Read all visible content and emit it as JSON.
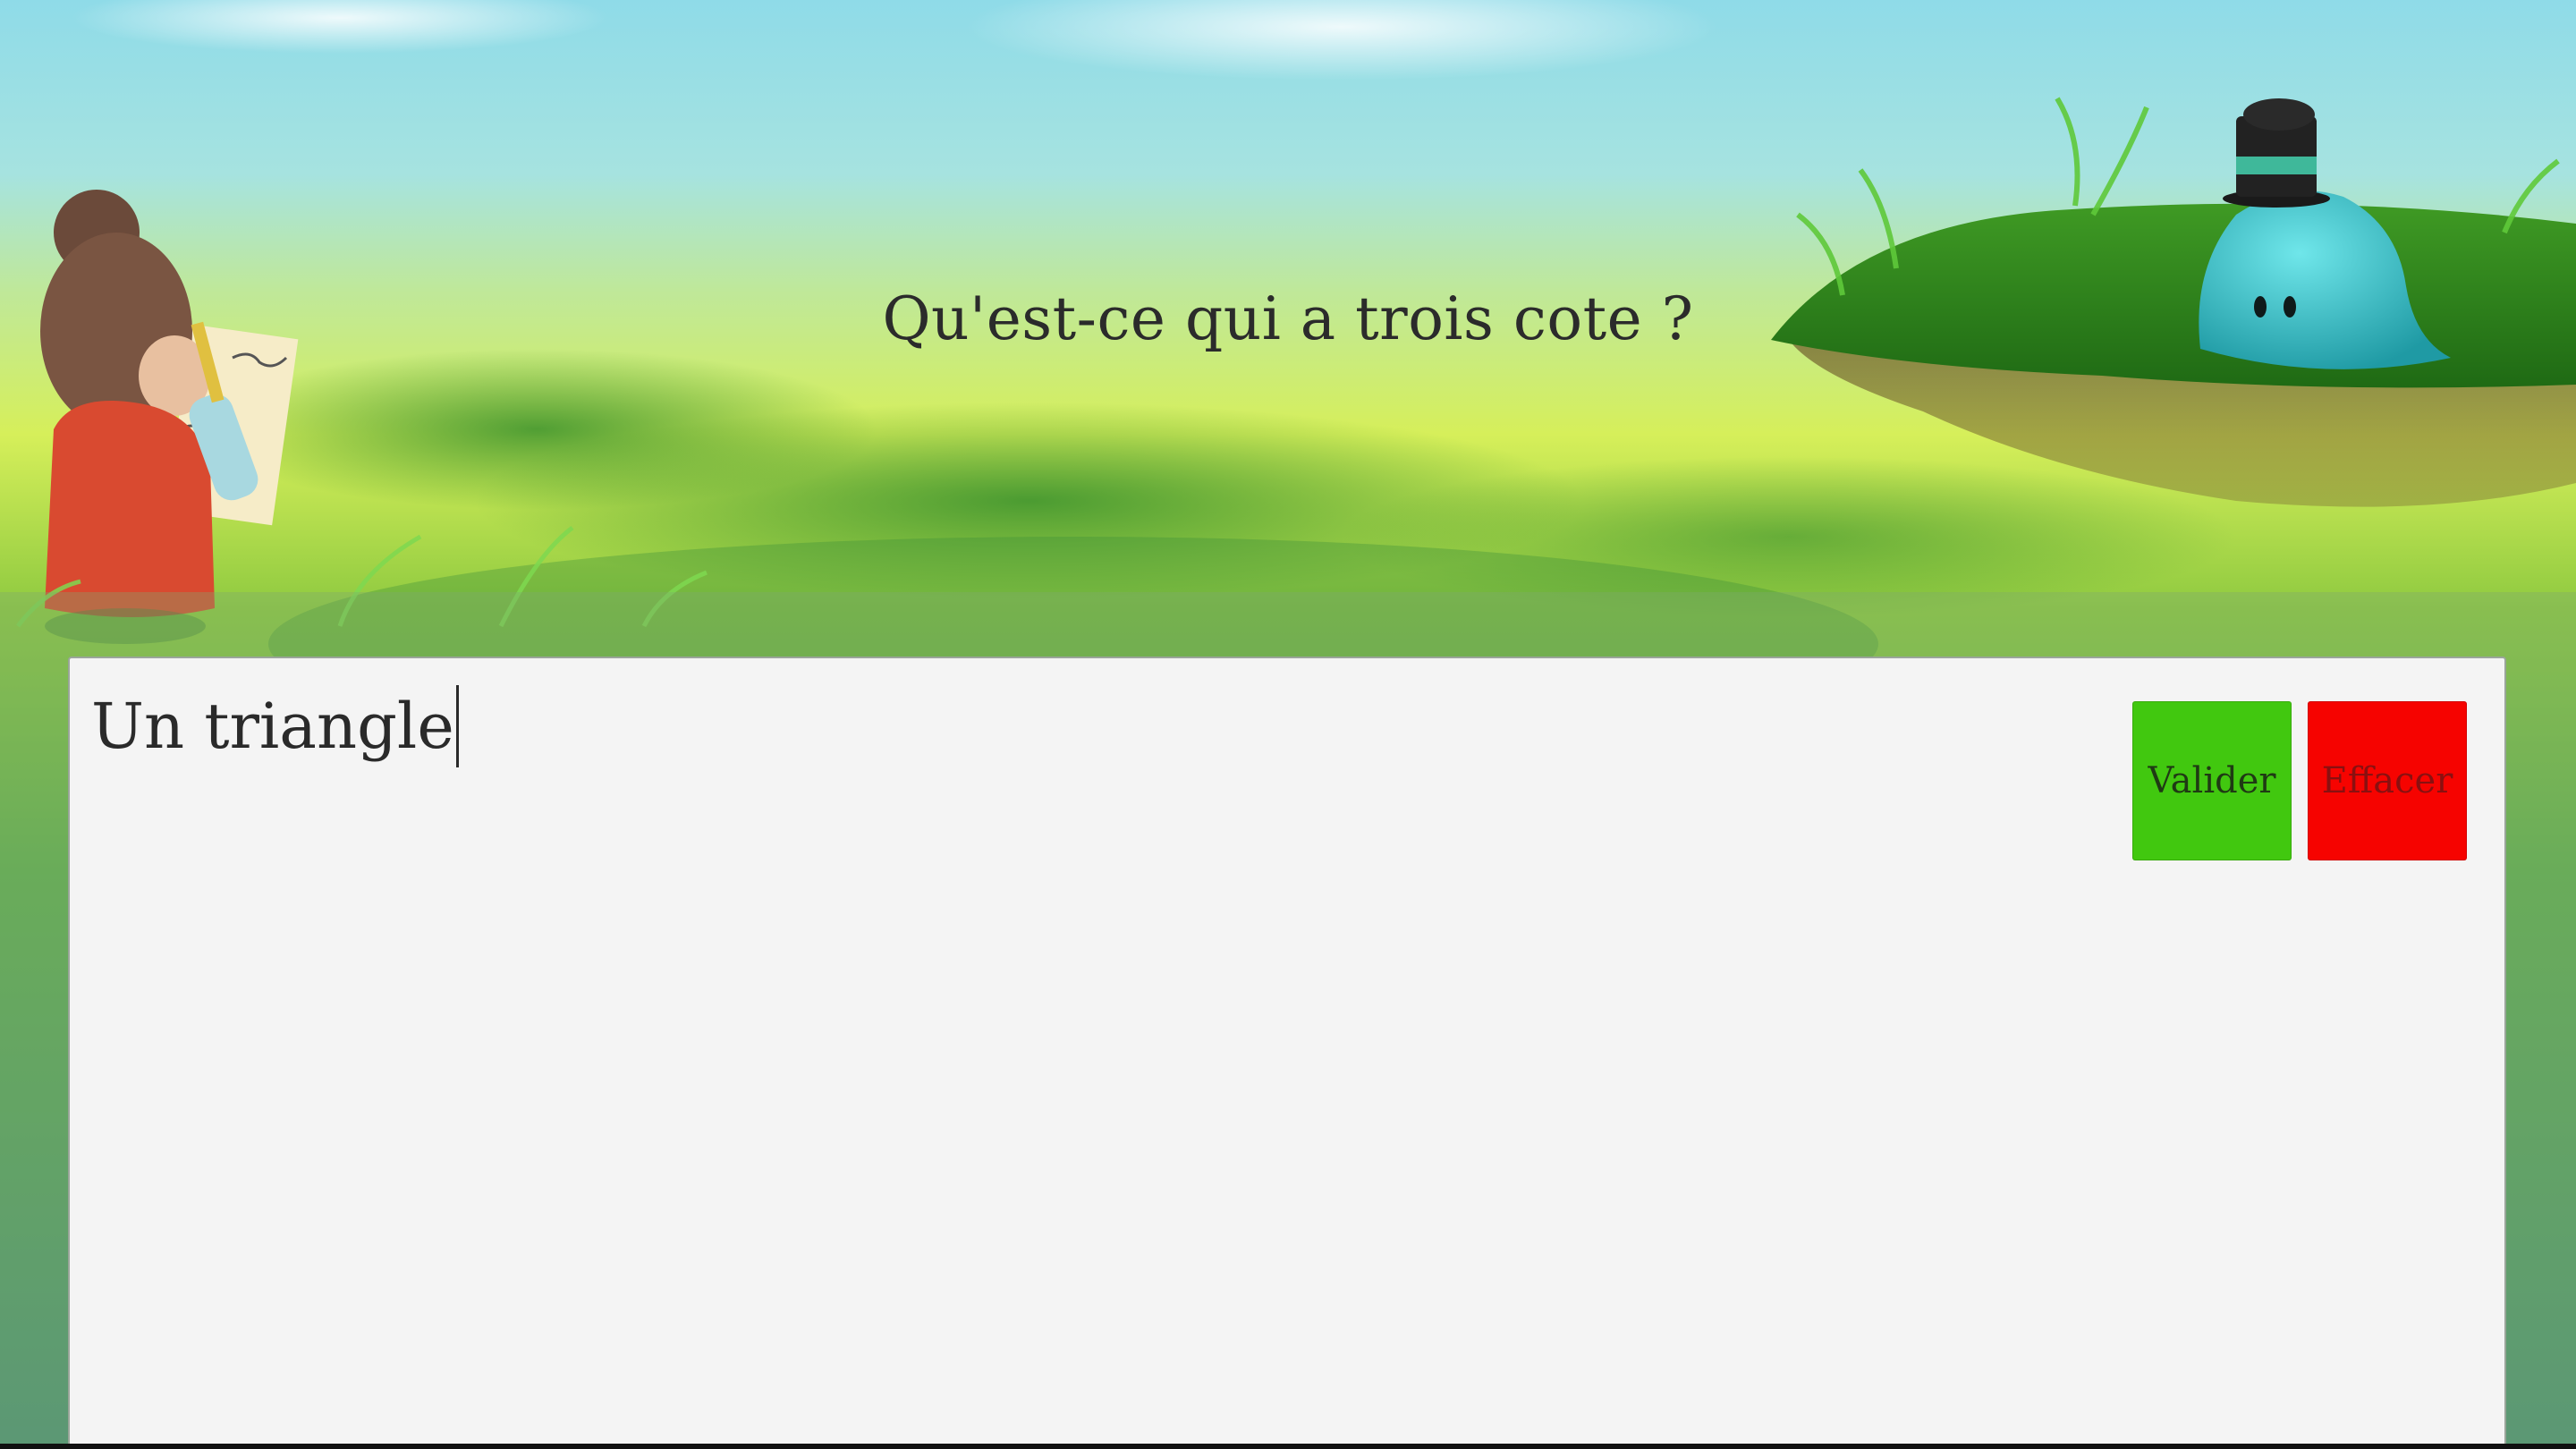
{
  "game": {
    "question": "Qu'est-ce qui a trois cote ?",
    "answer_value": "Un triangle",
    "buttons": {
      "validate_label": "Valider",
      "clear_label": "Effacer"
    }
  },
  "icons": {
    "girl": "girl-drawing-character-icon",
    "creature": "blob-creature-with-top-hat-icon"
  },
  "colors": {
    "validate": "#41c80f",
    "clear": "#f60300",
    "panel": "#f4f4f4",
    "sky_top": "#8fdbe8",
    "grass": "#c8e64a"
  }
}
